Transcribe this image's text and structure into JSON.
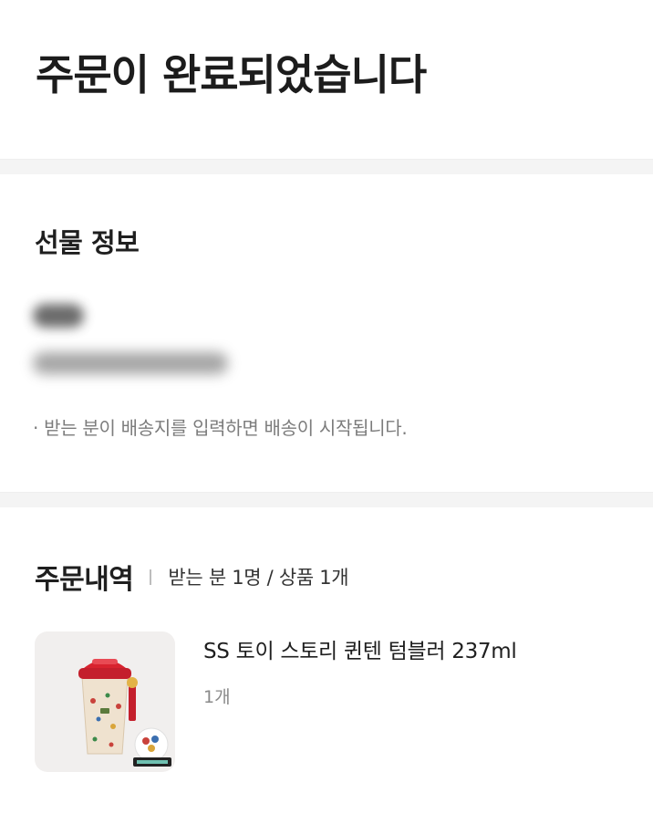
{
  "header": {
    "title": "주문이 완료되었습니다"
  },
  "gift_info": {
    "title": "선물 정보",
    "note": "· 받는 분이 배송지를 입력하면 배송이 시작됩니다."
  },
  "order_history": {
    "title": "주문내역",
    "summary": "받는 분 1명 / 상품 1개",
    "items": [
      {
        "name": "SS 토이 스토리 퀸텐 텀블러 237ml",
        "quantity": "1개",
        "image_icon": "tumbler-image"
      }
    ]
  },
  "colors": {
    "background": "#ffffff",
    "divider": "#f4f4f4",
    "tumbler_lid": "#d8232f",
    "tumbler_body": "#efe2cf"
  }
}
